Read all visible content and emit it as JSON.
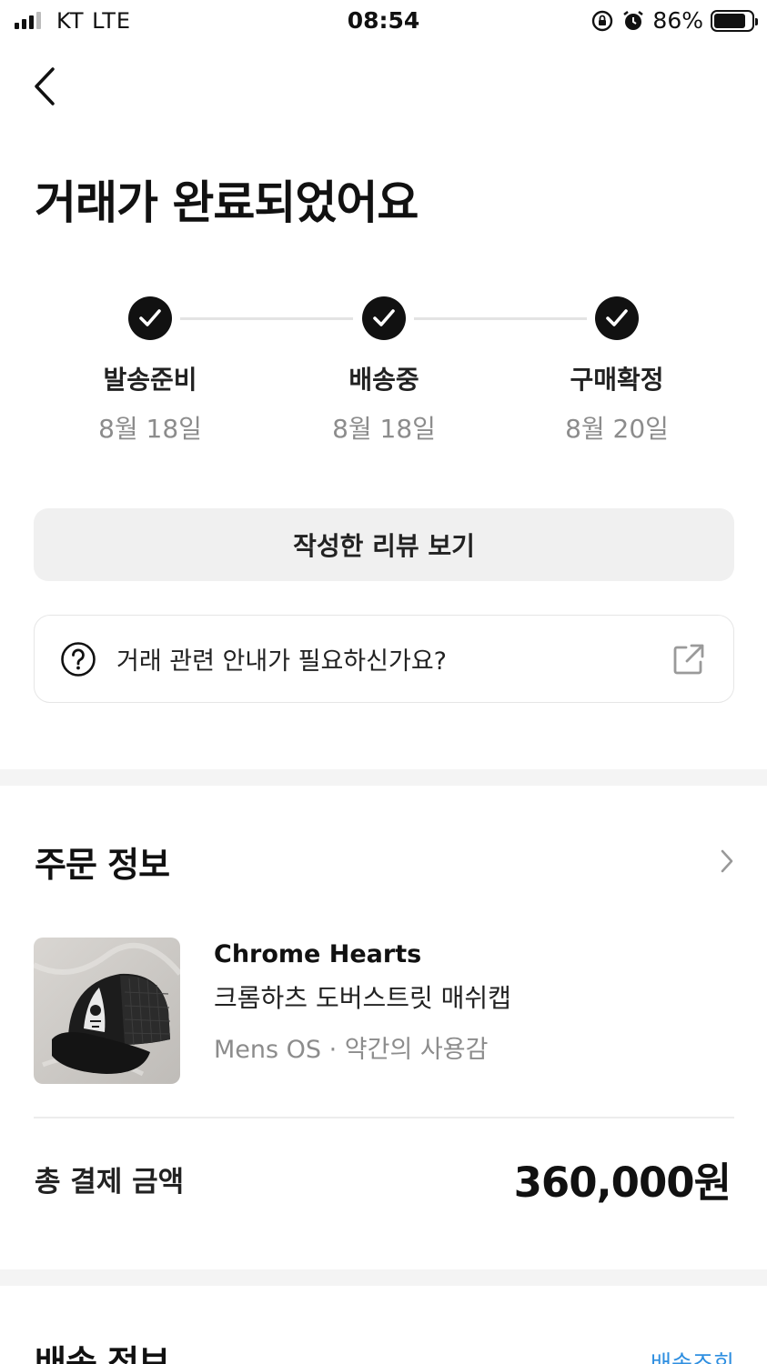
{
  "status_bar": {
    "carrier": "KT  LTE",
    "time": "08:54",
    "battery": "86%",
    "battery_level": 0.86
  },
  "header": {
    "title": "거래가 완료되었어요"
  },
  "progress": {
    "steps": [
      {
        "label": "발송준비",
        "date": "8월 18일",
        "completed": true
      },
      {
        "label": "배송중",
        "date": "8월 18일",
        "completed": true
      },
      {
        "label": "구매확정",
        "date": "8월 20일",
        "completed": true
      }
    ]
  },
  "actions": {
    "review_label": "작성한 리뷰 보기",
    "help_text": "거래 관련 안내가 필요하신가요?"
  },
  "order_info": {
    "title": "주문 정보",
    "product": {
      "brand": "Chrome Hearts",
      "name": "크롬하츠 도버스트릿 매쉬캡",
      "meta": "Mens OS · 약간의 사용감"
    },
    "total_label": "총 결제 금액",
    "total_value": "360,000원"
  },
  "shipping_info": {
    "title": "배송 정보",
    "tracking_label": "배송조회"
  },
  "colors": {
    "accent": "#2f8fe0",
    "text": "#111111",
    "muted": "#8c8c8c",
    "button_bg": "#f0f0f0"
  }
}
